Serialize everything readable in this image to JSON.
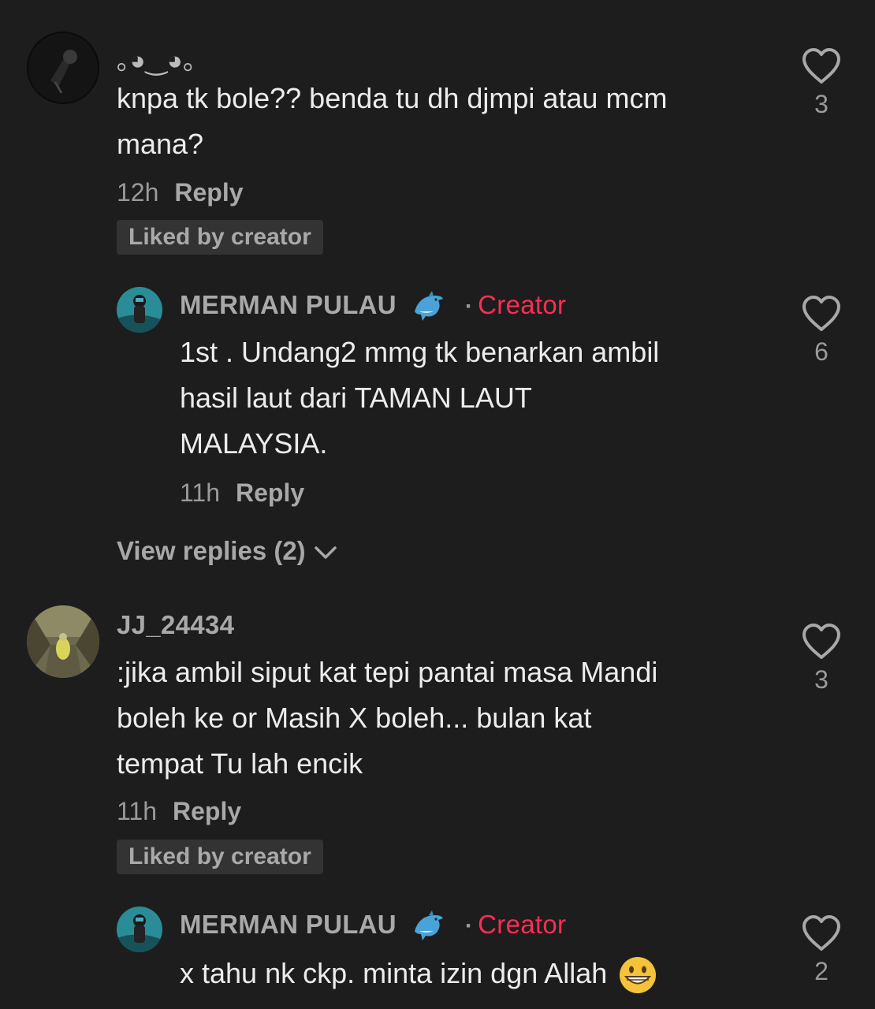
{
  "comments": [
    {
      "username": "｡◕‿◕｡",
      "text_lines": [
        "knpa tk bole?? benda tu dh djmpi atau mcm",
        "mana?"
      ],
      "time": "12h",
      "reply_label": "Reply",
      "liked_by_creator": "Liked by creator",
      "likes": "3"
    },
    {
      "username": "MERMAN PULAU",
      "creator_label": "Creator",
      "dot": "·",
      "text_lines": [
        "1st . Undang2 mmg tk benarkan ambil",
        "hasil laut dari TAMAN LAUT",
        "MALAYSIA."
      ],
      "time": "11h",
      "reply_label": "Reply",
      "likes": "6"
    },
    {
      "username": "JJ_24434",
      "text_lines": [
        ":jika ambil siput kat tepi pantai masa Mandi",
        "boleh ke or Masih X boleh... bulan kat",
        "tempat Tu lah encik"
      ],
      "time": "11h",
      "reply_label": "Reply",
      "liked_by_creator": "Liked by creator",
      "likes": "3"
    },
    {
      "username": "MERMAN PULAU",
      "creator_label": "Creator",
      "dot": "·",
      "text": "x tahu nk ckp. minta izin dgn Allah",
      "likes": "2"
    }
  ],
  "view_replies": "View replies (2)",
  "colors": {
    "background": "#1d1d1d",
    "creator": "#fe2c55",
    "badge": "#333333"
  },
  "icons": {
    "like": "heart-outline-icon",
    "expand": "chevron-down-icon",
    "dolphin": "dolphin-emoji-icon",
    "grin": "grinning-emoji-icon"
  }
}
